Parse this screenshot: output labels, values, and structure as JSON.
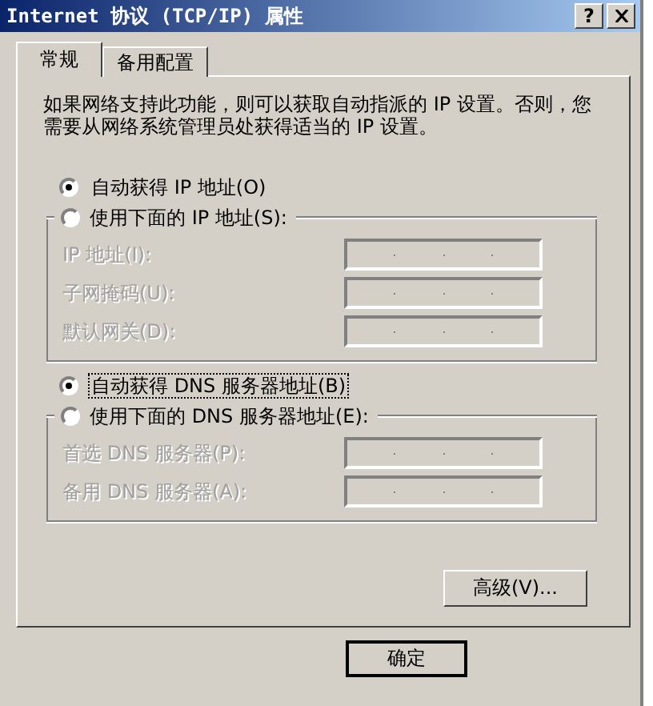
{
  "window": {
    "title": "Internet 协议 (TCP/IP) 属性",
    "help_button": "?"
  },
  "tabs": [
    {
      "label": "常规",
      "selected": true
    },
    {
      "label": "备用配置",
      "selected": false
    }
  ],
  "description": "如果网络支持此功能，则可以获取自动指派的 IP 设置。否则，您需要从网络系统管理员处获得适当的 IP 设置。",
  "sections": [
    {
      "auto_option": {
        "label": "自动获得 IP 地址(O)",
        "selected": true,
        "focused": false
      },
      "manual_option": {
        "label": "使用下面的 IP 地址(S):",
        "selected": false
      },
      "fields": [
        {
          "label": "IP 地址(I):",
          "disabled": true
        },
        {
          "label": "子网掩码(U):",
          "disabled": true
        },
        {
          "label": "默认网关(D):",
          "disabled": true
        }
      ]
    },
    {
      "auto_option": {
        "label": "自动获得 DNS 服务器地址(B)",
        "selected": true,
        "focused": true
      },
      "manual_option": {
        "label": "使用下面的 DNS 服务器地址(E):",
        "selected": false
      },
      "fields": [
        {
          "label": "首选 DNS 服务器(P):",
          "disabled": true
        },
        {
          "label": "备用 DNS 服务器(A):",
          "disabled": true
        }
      ]
    }
  ],
  "advanced_button": "高级(V)...",
  "buttons": [
    "确定"
  ]
}
